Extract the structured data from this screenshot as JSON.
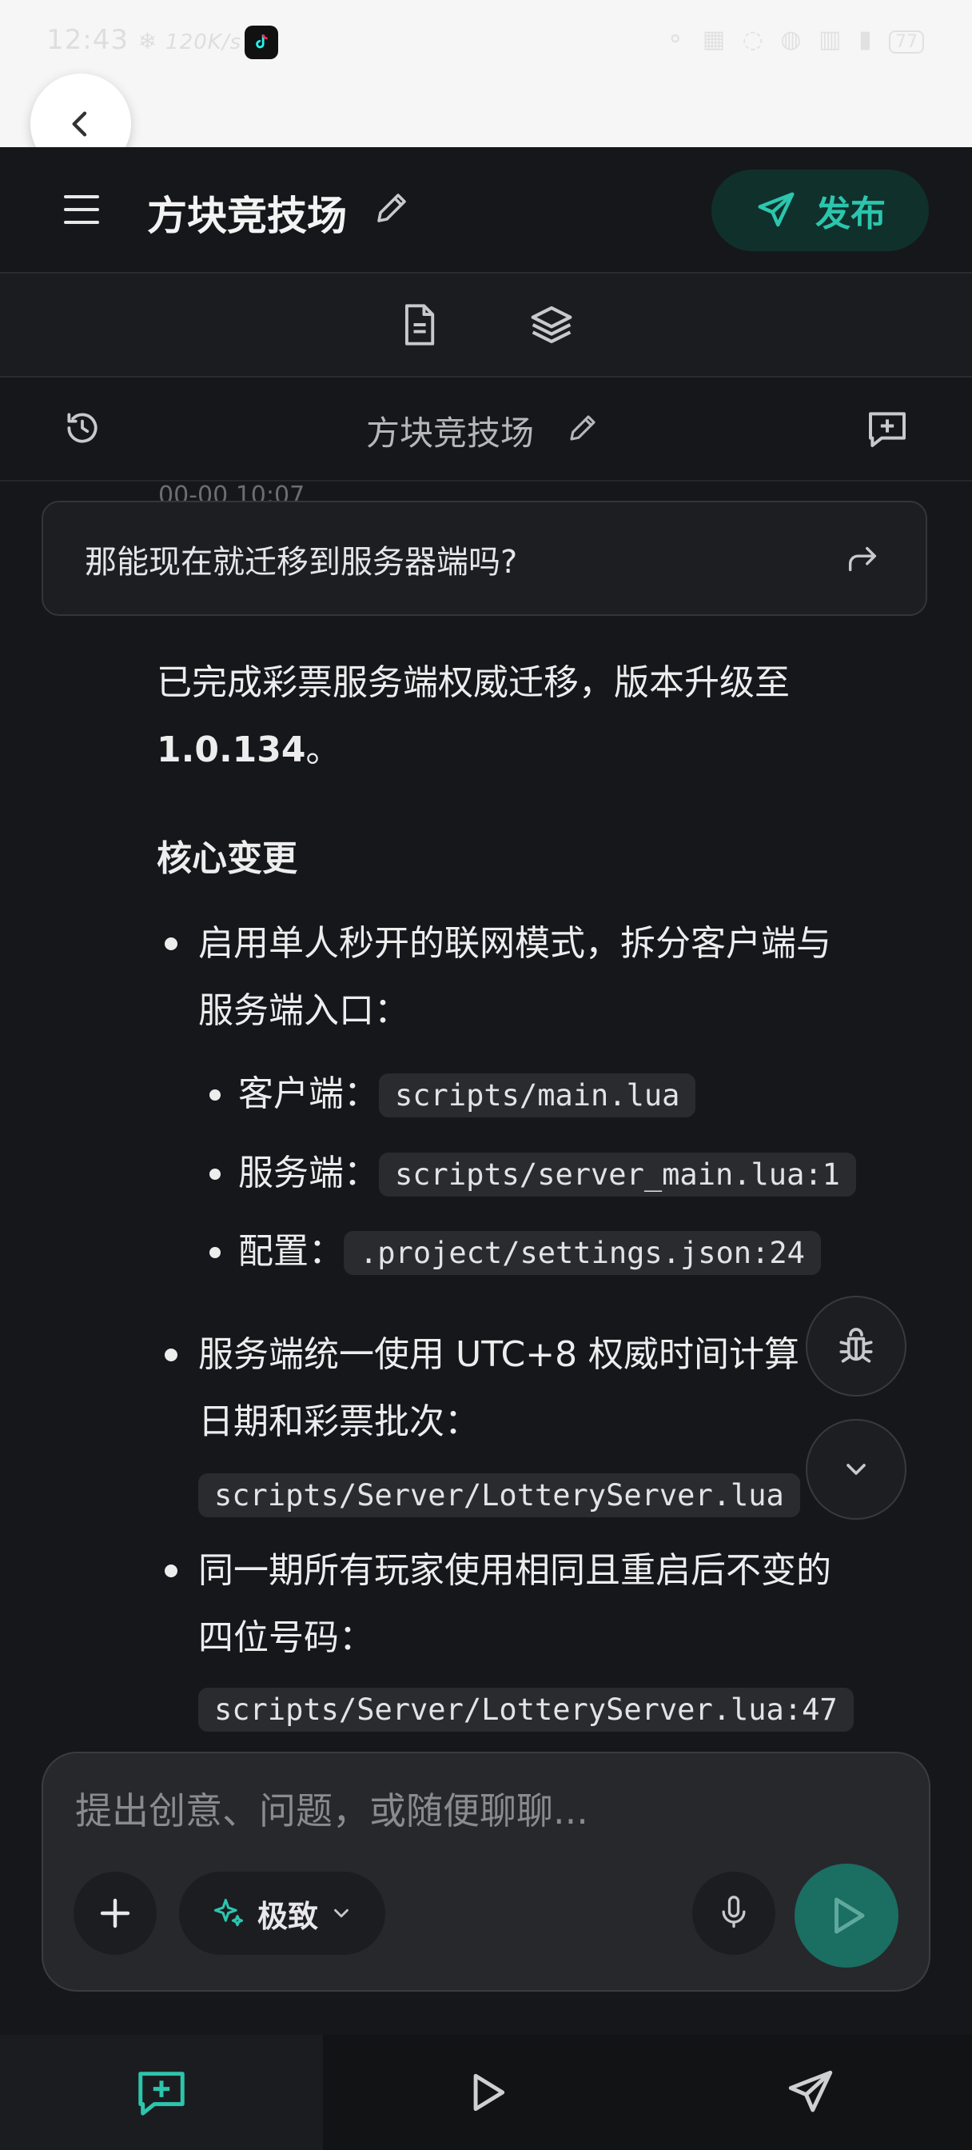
{
  "status_bar": {
    "time": "12:43",
    "network_speed": "120K/s",
    "battery": "77"
  },
  "header": {
    "title": "方块竞技场",
    "publish_label": "发布"
  },
  "chat_header": {
    "title": "方块竞技场"
  },
  "peek_timestamp": "00-00 10:07",
  "user_message": {
    "text": "那能现在就迁移到服务器端吗?"
  },
  "assistant_message": {
    "intro_part1": "已完成彩票服务端权威迁移，版本升级至",
    "version": "1.0.134",
    "intro_end": "。",
    "heading": "核心变更",
    "bullets": [
      {
        "line1": "启用单人秒开的联网模式，拆分客户端与",
        "line2": "服务端入口：",
        "sub": [
          {
            "label": "客户端：",
            "code": "scripts/main.lua"
          },
          {
            "label": "服务端：",
            "code": "scripts/server_main.lua:1"
          },
          {
            "label": "配置：",
            "code": ".project/settings.json:24"
          }
        ]
      },
      {
        "line1": "服务端统一使用 UTC+8 权威时间计算",
        "line2": "日期和彩票批次：",
        "code": "scripts/Server/LotteryServer.lua"
      },
      {
        "line1": "同一期所有玩家使用相同且重启后不变的",
        "line2": "四位号码：",
        "code": "scripts/Server/LotteryServer.lua:47"
      }
    ]
  },
  "composer": {
    "placeholder": "提出创意、问题，或随便聊聊...",
    "mode_label": "极致"
  },
  "colors": {
    "accent": "#2cc5ad",
    "background": "#16171a",
    "send_button": "#1a6e62"
  },
  "icons": [
    "back-icon",
    "menu-icon",
    "edit-icon",
    "send-icon",
    "document-icon",
    "layers-icon",
    "history-icon",
    "chat-add-icon",
    "share-icon",
    "bug-icon",
    "chevron-down-icon",
    "plus-icon",
    "sparkle-icon",
    "mic-icon",
    "play-icon"
  ]
}
